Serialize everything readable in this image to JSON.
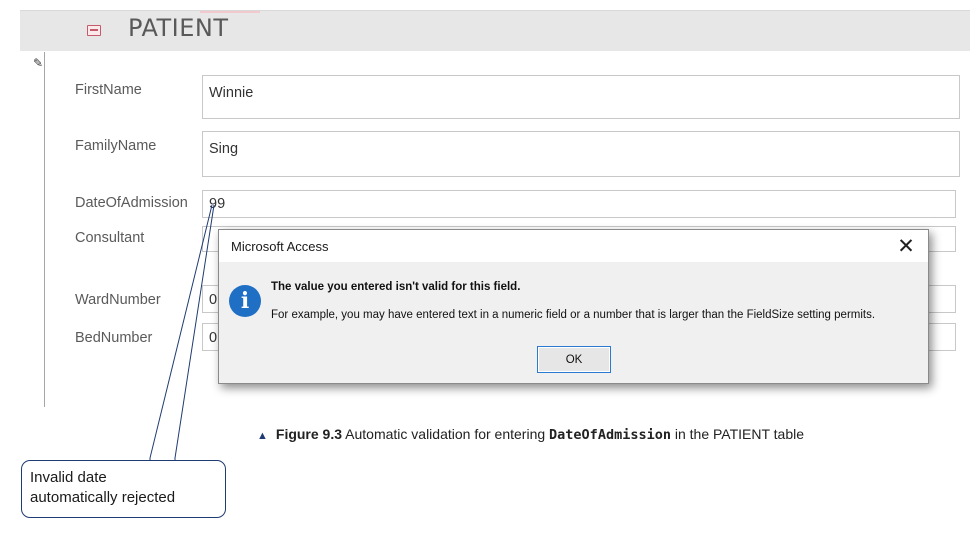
{
  "form": {
    "title": "PATIENT",
    "fields": [
      {
        "label": "FirstName",
        "value": "Winnie"
      },
      {
        "label": "FamilyName",
        "value": "Sing"
      },
      {
        "label": "DateOfAdmission",
        "value": "99"
      },
      {
        "label": "Consultant",
        "value": ""
      },
      {
        "label": "WardNumber",
        "value": "0"
      },
      {
        "label": "BedNumber",
        "value": "0"
      }
    ]
  },
  "dialog": {
    "title": "Microsoft Access",
    "close_glyph": "✕",
    "icon_glyph": "i",
    "message": "The value you entered isn't valid for this field.",
    "detail": "For example, you may have entered text in a numeric field or a number that is larger than the FieldSize setting permits.",
    "ok_label": "OK"
  },
  "caption": {
    "triangle": "▲",
    "figure": "Figure 9.3",
    "text_before": " Automatic validation for entering ",
    "code": "DateOfAdmission",
    "text_after": " in the PATIENT table"
  },
  "callout": {
    "line1": "Invalid date",
    "line2": "automatically rejected"
  },
  "colors": {
    "accent": "#1f6fc5",
    "callout_border": "#1f3b73"
  }
}
